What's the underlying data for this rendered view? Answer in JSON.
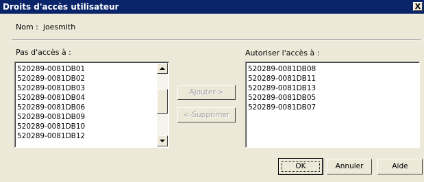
{
  "window": {
    "title": "Droits d'accès utilisateur",
    "close_label": "X"
  },
  "user": {
    "label": "Nom :",
    "value": "joesmith"
  },
  "no_access": {
    "label": "Pas d'accès à :",
    "items": [
      "520289-0081DB01",
      "520289-0081DB02",
      "520289-0081DB03",
      "520289-0081DB04",
      "520289-0081DB06",
      "520289-0081DB09",
      "520289-0081DB10",
      "520289-0081DB12"
    ]
  },
  "allow_access": {
    "label": "Autoriser l'accès à :",
    "items": [
      "520289-0081DB08",
      "520289-0081DB11",
      "520289-0081DB13",
      "520289-0081DB05",
      "520289-0081DB07"
    ]
  },
  "actions": {
    "add_label": "Ajouter->",
    "remove_label": "<-Supprimer"
  },
  "footer": {
    "ok_label": "OK",
    "cancel_label": "Annuler",
    "help_label": "Aide"
  },
  "colors": {
    "titlebar": "#0a246a",
    "dialog_bg": "#ece9d8"
  },
  "icons": {
    "scroll_up": "arrow-up",
    "scroll_down": "arrow-down"
  }
}
